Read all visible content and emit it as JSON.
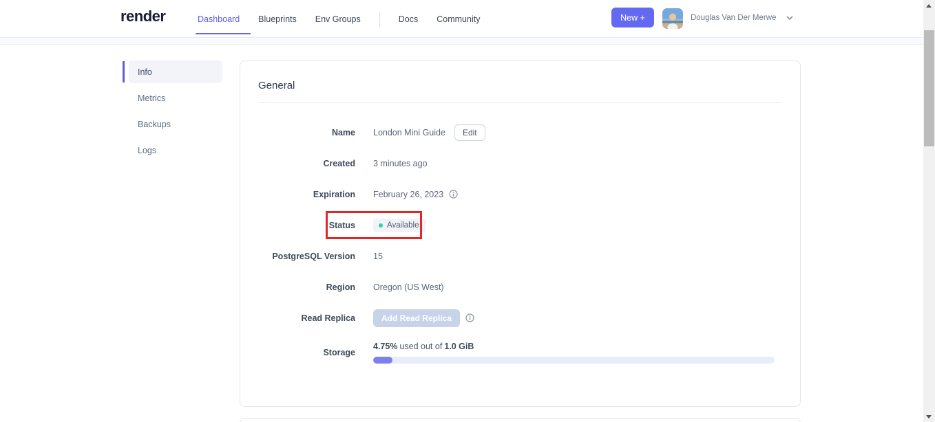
{
  "brand": {
    "logo_text": "render"
  },
  "nav": {
    "items": [
      {
        "label": "Dashboard",
        "active": true
      },
      {
        "label": "Blueprints",
        "active": false
      },
      {
        "label": "Env Groups",
        "active": false
      },
      {
        "label": "Docs",
        "active": false
      },
      {
        "label": "Community",
        "active": false
      }
    ],
    "new_button_label": "New +",
    "user_name": "Douglas Van Der Merwe"
  },
  "sidebar": {
    "items": [
      {
        "label": "Info",
        "active": true
      },
      {
        "label": "Metrics",
        "active": false
      },
      {
        "label": "Backups",
        "active": false
      },
      {
        "label": "Logs",
        "active": false
      }
    ]
  },
  "general": {
    "title": "General",
    "name": {
      "label": "Name",
      "value": "London Mini Guide",
      "edit_label": "Edit"
    },
    "created": {
      "label": "Created",
      "value": "3 minutes ago"
    },
    "expiration": {
      "label": "Expiration",
      "value": "February 26, 2023"
    },
    "status": {
      "label": "Status",
      "badge": "Available"
    },
    "version": {
      "label": "PostgreSQL Version",
      "value": "15"
    },
    "region": {
      "label": "Region",
      "value": "Oregon (US West)"
    },
    "read_replica": {
      "label": "Read Replica",
      "button_label": "Add Read Replica"
    },
    "storage": {
      "label": "Storage",
      "used_pct": "4.75%",
      "middle_text": "used out of",
      "total": "1.0 GiB",
      "progress_percent": 4.75
    }
  },
  "colors": {
    "accent_purple": "#5a5ce0",
    "new_button": "#6469f1",
    "status_dot_teal": "#35d09e",
    "annotation_red": "#e42525",
    "progress_fill": "#7b82f0",
    "progress_track": "#e9ecfa",
    "disabled_button": "#c7d3e9"
  }
}
